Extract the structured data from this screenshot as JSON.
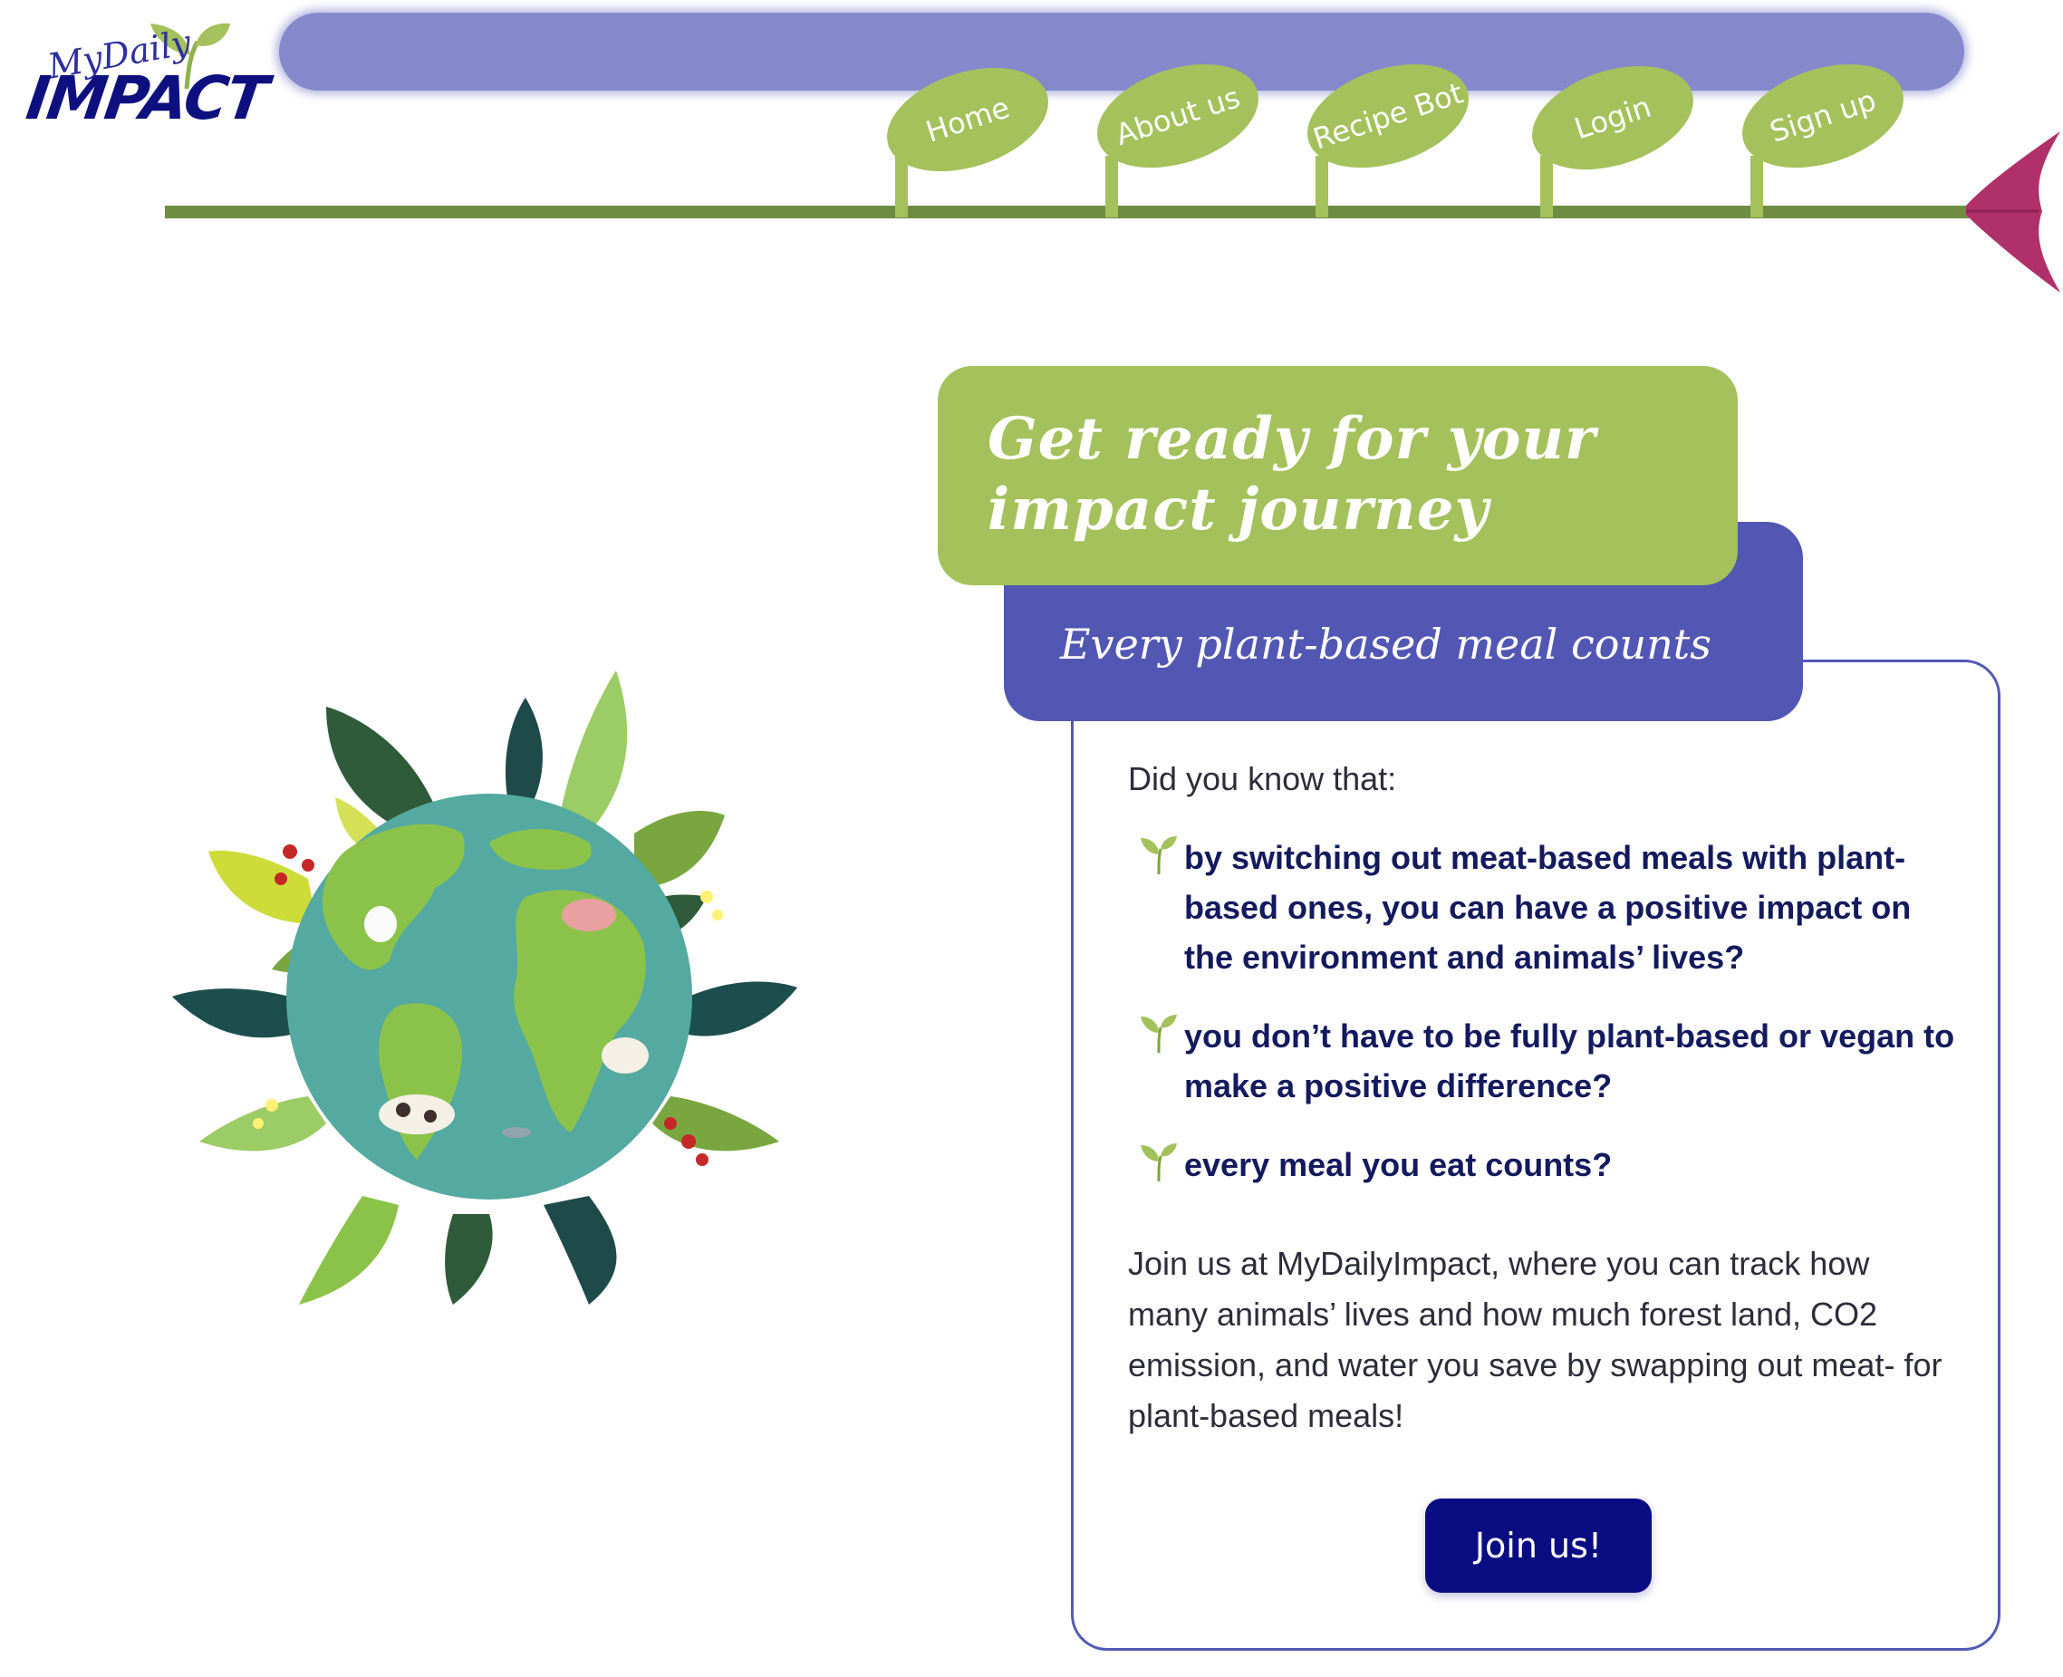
{
  "brand": {
    "script": "MyDaily",
    "main": "IMPACT"
  },
  "nav": [
    {
      "label": "Home"
    },
    {
      "label": "About us"
    },
    {
      "label": "Recipe Bot"
    },
    {
      "label": "Login"
    },
    {
      "label": "Sign up"
    }
  ],
  "hero": {
    "title": "Get ready for your impact journey",
    "subtitle": "Every plant-based meal counts"
  },
  "content": {
    "intro": "Did you know that:",
    "facts": [
      "by switching out meat-based meals with plant-based ones, you can have a positive impact on the environment and animals’ lives?",
      "you don’t have to be fully plant-based or vegan to make a positive difference?",
      "every meal you eat counts?"
    ],
    "join_text": "Join us at MyDailyImpact, where you can track how many animals’ lives and how much forest land, CO2 emission, and water you save by swapping out meat- for plant-based meals!",
    "join_button": "Join us!"
  },
  "colors": {
    "leaf_green": "#a4c15b",
    "stem_green": "#6e8c42",
    "top_bar": "#8589cc",
    "indigo": "#5257b3",
    "navy": "#0a0d82",
    "flower": "#b0306a"
  },
  "icons": {
    "logo": "sprout-logo-icon",
    "bullet": "sprout-icon",
    "flower": "flower-bud-icon",
    "illustration": "earth-globe-with-leaves-and-animals"
  }
}
